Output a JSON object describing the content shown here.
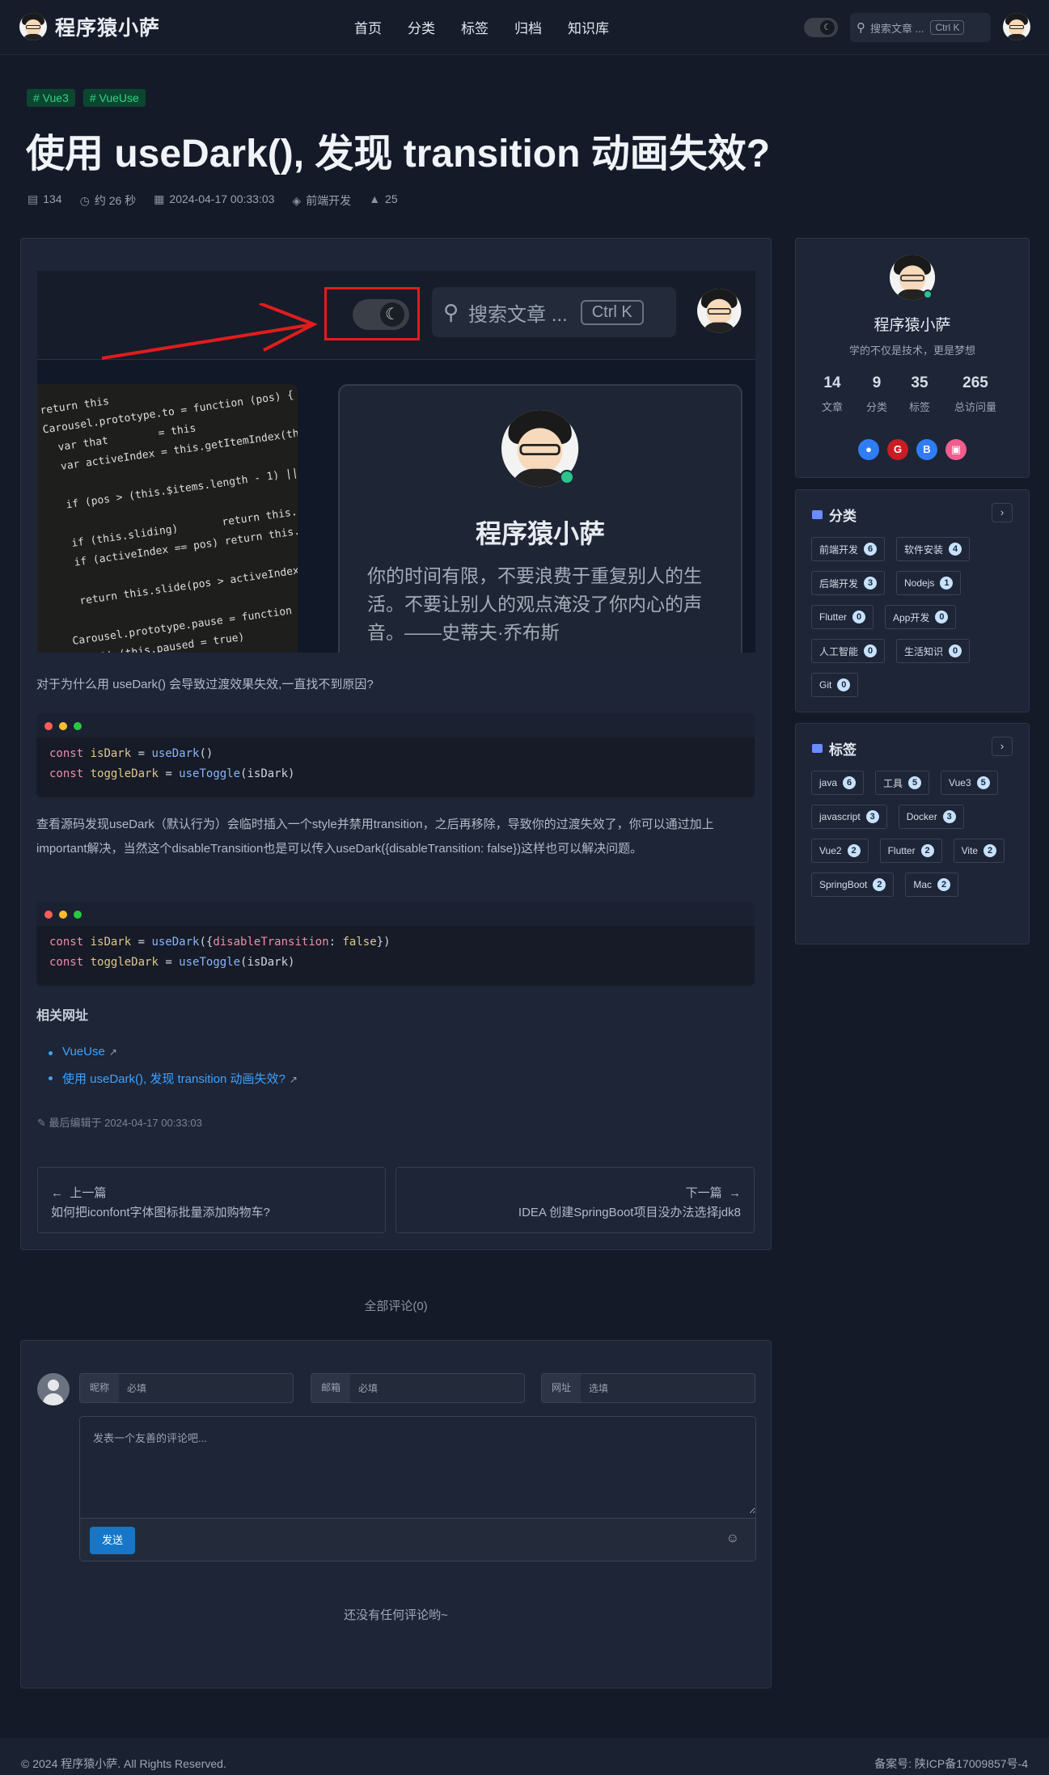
{
  "nav": {
    "site_name": "程序猿小萨",
    "menu": [
      "首页",
      "分类",
      "标签",
      "归档",
      "知识库"
    ],
    "search_placeholder": "搜索文章 ...",
    "search_shortcut": "Ctrl K",
    "toggle_icon": "moon-icon"
  },
  "post": {
    "tags": [
      "# Vue3",
      "# VueUse"
    ],
    "title": "使用 useDark(), 发现 transition 动画失效?",
    "meta": {
      "words": "134",
      "read_time": "约 26 秒",
      "date": "2024-04-17 00:33:03",
      "category": "前端开发",
      "views": "25"
    },
    "hero": {
      "search_text": "搜索文章 ...",
      "shortcut": "Ctrl K",
      "profile_name": "程序猿小萨",
      "profile_quote": "你的时间有限，不要浪费于重复别人的生活。不要让别人的观点淹没了你内心的声音。——史蒂夫·乔布斯",
      "code_image": "return this\nCarousel.prototype.to = function (pos) {\n  var that        = this\n  var activeIndex = this.getItemIndex(this.$active = this\n\n  if (pos > (this.$items.length - 1) || pos < 0) return\n\n  if (this.sliding)       return this.$element.one('slid.\n  if (activeIndex == pos) return this.pause().cycle()\n\n  return this.slide(pos > activeIndex ? 'next' : 'prev',\n\nCarousel.prototype.pause = function (e) {\n  e || (this.paused = true)\n\n  if (this.$element.find('.next, .prev').length && $.supp"
    },
    "intro": "对于为什么用 useDark() 会导致过渡效果失效,一直找不到原因?",
    "explain": "查看源码发现useDark（默认行为）会临时插入一个style并禁用transition，之后再移除，导致你的过渡失效了，你可以通过加上important解决，当然这个disableTransition也是可以传入useDark({disableTransition: false})这样也可以解决问题。",
    "code1": {
      "l1a": "const",
      "l1b": " isDark ",
      "l1c": "= ",
      "l1d": "useDark",
      "l1e": "()",
      "l2a": "const",
      "l2b": " toggleDark ",
      "l2c": "= ",
      "l2d": "useToggle",
      "l2e": "(isDark)"
    },
    "code2": {
      "l1a": "const",
      "l1b": " isDark ",
      "l1c": "= ",
      "l1d": "useDark",
      "l1e": "({",
      "l1f": "disableTransition",
      "l1g": ": ",
      "l1h": "false",
      "l1i": "})",
      "l2a": "const",
      "l2b": " toggleDark ",
      "l2c": "= ",
      "l2d": "useToggle",
      "l2e": "(isDark)"
    },
    "related_heading": "相关网址",
    "related_links": [
      "VueUse",
      "使用 useDark(), 发现 transition 动画失效?"
    ],
    "last_edited": "最后编辑于 2024-04-17 00:33:03",
    "prev": {
      "label": "上一篇",
      "title": "如何把iconfont字体图标批量添加购物车?"
    },
    "next": {
      "label": "下一篇",
      "title": "IDEA 创建SpringBoot项目没办法选择jdk8"
    }
  },
  "sidebar": {
    "profile": {
      "name": "程序猿小萨",
      "motto": "学的不仅是技术，更是梦想",
      "stats": [
        {
          "n": "14",
          "l": "文章"
        },
        {
          "n": "9",
          "l": "分类"
        },
        {
          "n": "35",
          "l": "标签"
        },
        {
          "n": "265",
          "l": "总访问量"
        }
      ],
      "socials": [
        {
          "icon": "github-icon",
          "glyph": "●",
          "color": "#2f7df6"
        },
        {
          "icon": "gitee-icon",
          "glyph": "G",
          "color": "#c71d23"
        },
        {
          "icon": "blog-icon",
          "glyph": "B",
          "color": "#2f7df6"
        },
        {
          "icon": "bilibili-icon",
          "glyph": "▣",
          "color": "#f25d8e"
        }
      ]
    },
    "categories": {
      "title": "分类",
      "items": [
        {
          "name": "前端开发",
          "count": "6"
        },
        {
          "name": "软件安装",
          "count": "4"
        },
        {
          "name": "后端开发",
          "count": "3"
        },
        {
          "name": "Nodejs",
          "count": "1"
        },
        {
          "name": "Flutter",
          "count": "0"
        },
        {
          "name": "App开发",
          "count": "0"
        },
        {
          "name": "人工智能",
          "count": "0"
        },
        {
          "name": "生活知识",
          "count": "0"
        },
        {
          "name": "Git",
          "count": "0"
        }
      ]
    },
    "tags": {
      "title": "标签",
      "items": [
        {
          "name": "java",
          "count": "6"
        },
        {
          "name": "工具",
          "count": "5"
        },
        {
          "name": "Vue3",
          "count": "5"
        },
        {
          "name": "javascript",
          "count": "3"
        },
        {
          "name": "Docker",
          "count": "3"
        },
        {
          "name": "Vue2",
          "count": "2"
        },
        {
          "name": "Flutter",
          "count": "2"
        },
        {
          "name": "Vite",
          "count": "2"
        },
        {
          "name": "SpringBoot",
          "count": "2"
        },
        {
          "name": "Mac",
          "count": "2"
        }
      ]
    }
  },
  "comments": {
    "count_label": "全部评论(0)",
    "nick_label": "昵称",
    "nick_placeholder": "必填",
    "mail_label": "邮箱",
    "mail_placeholder": "必填",
    "site_label": "网址",
    "site_placeholder": "选填",
    "textarea_placeholder": "发表一个友善的评论吧...",
    "send_label": "发送",
    "empty": "还没有任何评论哟~"
  },
  "footer": {
    "copyright": "© 2024 程序猿小萨. All Rights Reserved.",
    "icp": "备案号: 陕ICP备17009857号-4"
  }
}
